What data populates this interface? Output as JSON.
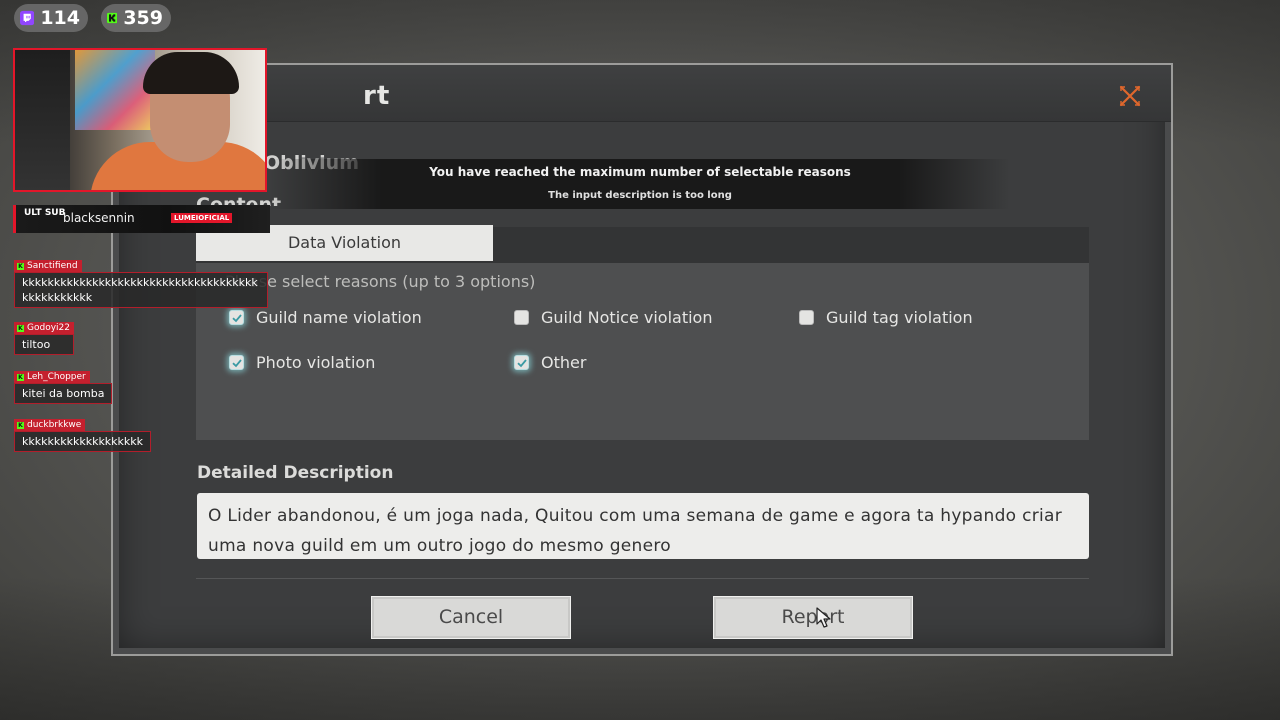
{
  "stream_overlay": {
    "twitch_viewers": "114",
    "kick_viewers": "359",
    "streamer_name": "blacksennin",
    "banner_logo": "ULT SUB",
    "banner_tag": "LUMEIOFICIAL",
    "chat": [
      {
        "user": "Sanctifiend",
        "text": "kkkkkkkkkkkkkkkkkkkkkkkkkkkkkkkkkkkkk kkkkkkkkkkk"
      },
      {
        "user": "Godoyi22",
        "text": "tiltoo"
      },
      {
        "user": "Leh_Chopper",
        "text": "kitei da bomba"
      },
      {
        "user": "duckbrkkwe",
        "text": "kkkkkkkkkkkkkkkkkkk"
      }
    ]
  },
  "dialog": {
    "title": "rt",
    "target": "Oblivium",
    "content_label": "Content",
    "toast_line1": "You have reached the maximum number of selectable reasons",
    "toast_line2": "The input description is too long",
    "active_tab": "Data Violation",
    "reasons_hint": "Please select reasons (up to 3 options)",
    "reasons": [
      {
        "label": "Guild name violation",
        "checked": true
      },
      {
        "label": "Guild Notice violation",
        "checked": false
      },
      {
        "label": "Guild tag violation",
        "checked": false
      },
      {
        "label": "Photo violation",
        "checked": true
      },
      {
        "label": "Other",
        "checked": true
      }
    ],
    "description_title": "Detailed Description",
    "description_value": "O Lider abandonou, é um joga nada, Quitou com uma semana de game e agora ta hypando criar uma nova guild em um outro jogo do mesmo genero",
    "cancel_label": "Cancel",
    "report_label": "Report"
  },
  "colors": {
    "accent_check_glow": "#8cdce1",
    "close_icon": "#e0672c",
    "overlay_red": "#e3162a",
    "kick_green": "#53fc18",
    "twitch_purple": "#9146ff"
  }
}
